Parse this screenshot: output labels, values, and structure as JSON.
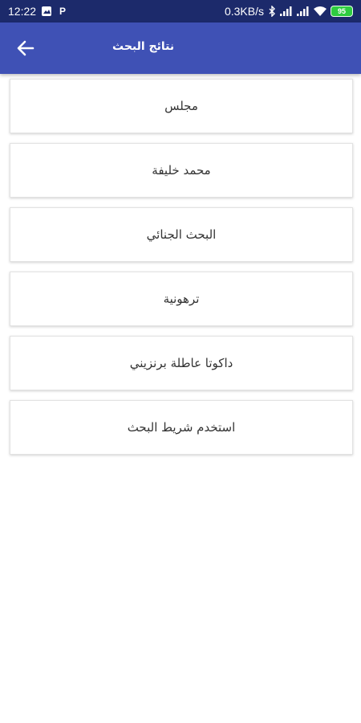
{
  "status_bar": {
    "time": "12:22",
    "network_speed": "0.3KB/s",
    "battery": "95",
    "p_badge": "P",
    "icons": [
      "photo-icon",
      "p-icon",
      "bluetooth-icon",
      "signal-icon",
      "signal-icon",
      "wifi-icon",
      "battery-icon"
    ]
  },
  "app_bar": {
    "title": "نتائج البحث",
    "color": "#3f51b5",
    "back_icon": "arrow-left-icon"
  },
  "results": [
    {
      "label": "مجلس"
    },
    {
      "label": "محمد خليفة"
    },
    {
      "label": "البحث الجنائي"
    },
    {
      "label": "ترهونية"
    },
    {
      "label": "داكوتا عاطلة برنزيني"
    },
    {
      "label": "استخدم شريط البحث"
    }
  ]
}
